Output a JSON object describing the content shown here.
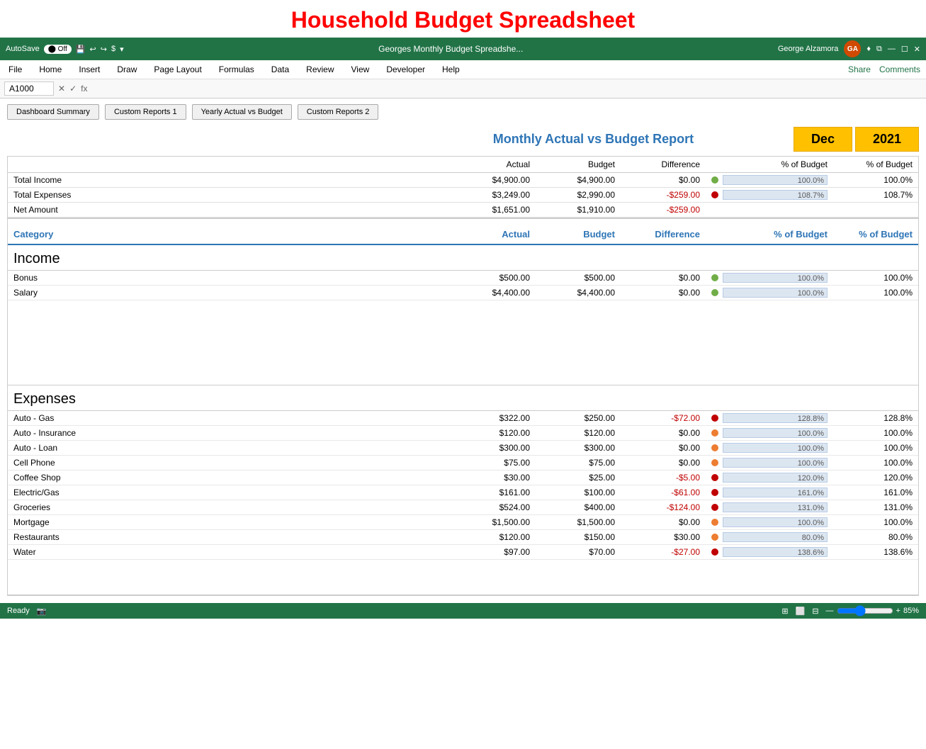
{
  "page": {
    "main_title": "Household Budget Spreadsheet"
  },
  "titlebar": {
    "autosave_label": "AutoSave",
    "autosave_state": "Off",
    "file_name": "Georges Monthly Budget Spreadshe...",
    "user_name": "George Alzamora",
    "user_initials": "GA"
  },
  "menubar": {
    "items": [
      "File",
      "Home",
      "Insert",
      "Draw",
      "Page Layout",
      "Formulas",
      "Data",
      "Review",
      "View",
      "Developer",
      "Help"
    ],
    "share_label": "Share",
    "comments_label": "Comments"
  },
  "formulabar": {
    "cell_ref": "A1000",
    "fx_symbol": "fx"
  },
  "nav_buttons": [
    "Dashboard Summary",
    "Custom Reports 1",
    "Yearly Actual vs Budget",
    "Custom Reports 2"
  ],
  "report": {
    "title": "Monthly Actual vs Budget Report",
    "month": "Dec",
    "year": "2021"
  },
  "summary_headers": [
    "",
    "Actual",
    "Budget",
    "Difference",
    "% of Budget",
    "% of Budget"
  ],
  "summary_rows": [
    {
      "label": "Total Income",
      "actual": "$4,900.00",
      "budget": "$4,900.00",
      "difference": "$0.00",
      "dot": "green",
      "pct_bar": 100.0,
      "pct_bar_label": "100.0%",
      "pct_val": "100.0%",
      "diff_neg": false
    },
    {
      "label": "Total Expenses",
      "actual": "$3,249.00",
      "budget": "$2,990.00",
      "difference": "-$259.00",
      "dot": "red",
      "pct_bar": 100.0,
      "pct_bar_label": "108.7%",
      "pct_val": "108.7%",
      "diff_neg": true
    },
    {
      "label": "Net Amount",
      "actual": "$1,651.00",
      "budget": "$1,910.00",
      "difference": "-$259.00",
      "dot": "none",
      "pct_bar": 0,
      "pct_bar_label": "",
      "pct_val": "",
      "diff_neg": true
    }
  ],
  "cat_headers": [
    "Category",
    "Actual",
    "Budget",
    "Difference",
    "% of Budget",
    "% of Budget"
  ],
  "income_section_title": "Income",
  "income_rows": [
    {
      "label": "Bonus",
      "actual": "$500.00",
      "budget": "$500.00",
      "difference": "$0.00",
      "dot": "green",
      "pct_bar": 100.0,
      "pct_bar_label": "100.0%",
      "pct_val": "100.0%",
      "diff_neg": false
    },
    {
      "label": "Salary",
      "actual": "$4,400.00",
      "budget": "$4,400.00",
      "difference": "$0.00",
      "dot": "green",
      "pct_bar": 100.0,
      "pct_bar_label": "100.0%",
      "pct_val": "100.0%",
      "diff_neg": false
    }
  ],
  "expenses_section_title": "Expenses",
  "expense_rows": [
    {
      "label": "Auto - Gas",
      "actual": "$322.00",
      "budget": "$250.00",
      "difference": "-$72.00",
      "dot": "red",
      "pct_bar": 100.0,
      "pct_bar_label": "128.8%",
      "pct_val": "128.8%",
      "diff_neg": true
    },
    {
      "label": "Auto - Insurance",
      "actual": "$120.00",
      "budget": "$120.00",
      "difference": "$0.00",
      "dot": "orange",
      "pct_bar": 100.0,
      "pct_bar_label": "100.0%",
      "pct_val": "100.0%",
      "diff_neg": false
    },
    {
      "label": "Auto - Loan",
      "actual": "$300.00",
      "budget": "$300.00",
      "difference": "$0.00",
      "dot": "orange",
      "pct_bar": 100.0,
      "pct_bar_label": "100.0%",
      "pct_val": "100.0%",
      "diff_neg": false
    },
    {
      "label": "Cell Phone",
      "actual": "$75.00",
      "budget": "$75.00",
      "difference": "$0.00",
      "dot": "orange",
      "pct_bar": 100.0,
      "pct_bar_label": "100.0%",
      "pct_val": "100.0%",
      "diff_neg": false
    },
    {
      "label": "Coffee Shop",
      "actual": "$30.00",
      "budget": "$25.00",
      "difference": "-$5.00",
      "dot": "red",
      "pct_bar": 100.0,
      "pct_bar_label": "120.0%",
      "pct_val": "120.0%",
      "diff_neg": true
    },
    {
      "label": "Electric/Gas",
      "actual": "$161.00",
      "budget": "$100.00",
      "difference": "-$61.00",
      "dot": "red",
      "pct_bar": 100.0,
      "pct_bar_label": "161.0%",
      "pct_val": "161.0%",
      "diff_neg": true
    },
    {
      "label": "Groceries",
      "actual": "$524.00",
      "budget": "$400.00",
      "difference": "-$124.00",
      "dot": "red",
      "pct_bar": 100.0,
      "pct_bar_label": "131.0%",
      "pct_val": "131.0%",
      "diff_neg": true
    },
    {
      "label": "Mortgage",
      "actual": "$1,500.00",
      "budget": "$1,500.00",
      "difference": "$0.00",
      "dot": "orange",
      "pct_bar": 100.0,
      "pct_bar_label": "100.0%",
      "pct_val": "100.0%",
      "diff_neg": false
    },
    {
      "label": "Restaurants",
      "actual": "$120.00",
      "budget": "$150.00",
      "difference": "$30.00",
      "dot": "orange",
      "pct_bar": 80.0,
      "pct_bar_label": "80.0%",
      "pct_val": "80.0%",
      "diff_neg": false
    },
    {
      "label": "Water",
      "actual": "$97.00",
      "budget": "$70.00",
      "difference": "-$27.00",
      "dot": "red",
      "pct_bar": 100.0,
      "pct_bar_label": "138.6%",
      "pct_val": "138.6%",
      "diff_neg": true
    }
  ],
  "statusbar": {
    "ready_label": "Ready",
    "zoom_label": "85%"
  }
}
